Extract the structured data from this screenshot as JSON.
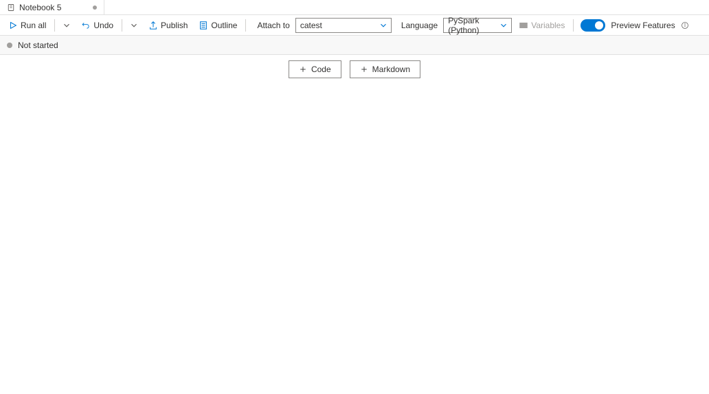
{
  "tab": {
    "title": "Notebook 5"
  },
  "toolbar": {
    "run_all": "Run all",
    "undo": "Undo",
    "publish": "Publish",
    "outline": "Outline",
    "attach_label": "Attach to",
    "attach_value": "catest",
    "language_label": "Language",
    "language_value": "PySpark (Python)",
    "variables": "Variables",
    "preview": "Preview Features"
  },
  "status": {
    "text": "Not started"
  },
  "actions": {
    "code": "Code",
    "markdown": "Markdown"
  }
}
